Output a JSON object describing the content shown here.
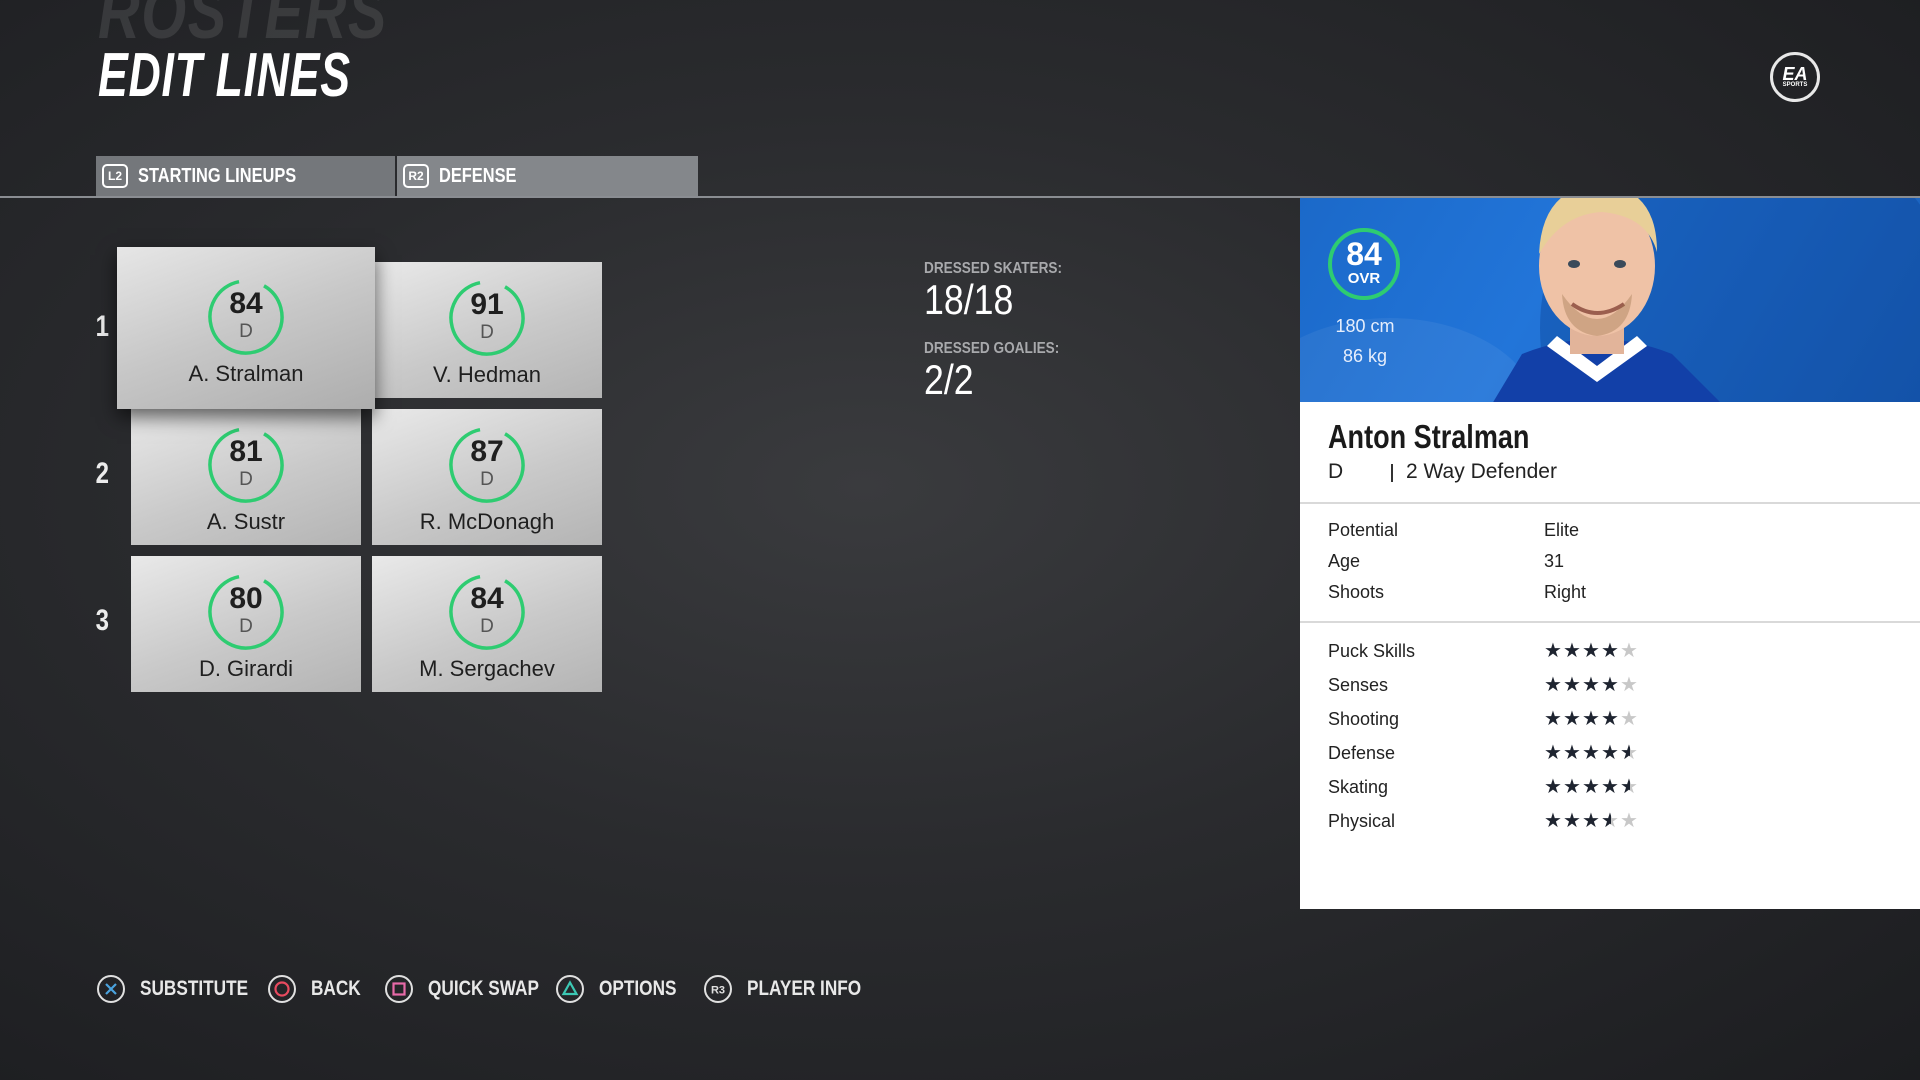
{
  "header": {
    "bg_title": "ROSTERS",
    "title": "EDIT LINES",
    "logo_text": "EA",
    "logo_sub": "SPORTS"
  },
  "tabs": [
    {
      "badge": "L2",
      "label": "STARTING LINEUPS"
    },
    {
      "badge": "R2",
      "label": "DEFENSE"
    }
  ],
  "lines": [
    {
      "number": "1",
      "players": [
        {
          "ovr": 84,
          "pos": "D",
          "name": "A. Stralman",
          "selected": true
        },
        {
          "ovr": 91,
          "pos": "D",
          "name": "V. Hedman"
        }
      ]
    },
    {
      "number": "2",
      "players": [
        {
          "ovr": 81,
          "pos": "D",
          "name": "A. Sustr"
        },
        {
          "ovr": 87,
          "pos": "D",
          "name": "R. McDonagh"
        }
      ]
    },
    {
      "number": "3",
      "players": [
        {
          "ovr": 80,
          "pos": "D",
          "name": "D. Girardi"
        },
        {
          "ovr": 84,
          "pos": "D",
          "name": "M. Sergachev"
        }
      ]
    }
  ],
  "dressed": {
    "skaters_label": "DRESSED SKATERS:",
    "skaters_value": "18/18",
    "goalies_label": "DRESSED GOALIES:",
    "goalies_value": "2/2"
  },
  "player": {
    "ovr": "84",
    "ovr_label": "OVR",
    "height": "180 cm",
    "weight": "86 kg",
    "name": "Anton Stralman",
    "position": "D",
    "type": "2 Way Defender",
    "info": [
      {
        "label": "Potential",
        "value": "Elite"
      },
      {
        "label": "Age",
        "value": "31"
      },
      {
        "label": "Shoots",
        "value": "Right"
      }
    ],
    "attributes": [
      {
        "label": "Puck Skills",
        "stars": 4,
        "max": 5
      },
      {
        "label": "Senses",
        "stars": 4,
        "max": 5
      },
      {
        "label": "Shooting",
        "stars": 4,
        "max": 5
      },
      {
        "label": "Defense",
        "stars": 4.5,
        "max": 5
      },
      {
        "label": "Skating",
        "stars": 4.5,
        "max": 5
      },
      {
        "label": "Physical",
        "stars": 3.5,
        "max": 5
      }
    ],
    "header_color": "#1f6fd1"
  },
  "footer": [
    {
      "icon": "cross-button-icon",
      "label": "SUBSTITUTE"
    },
    {
      "icon": "circle-button-icon",
      "label": "BACK"
    },
    {
      "icon": "square-button-icon",
      "label": "QUICK SWAP"
    },
    {
      "icon": "triangle-button-icon",
      "label": "OPTIONS"
    },
    {
      "icon": "r3-button-icon",
      "badge": "R3",
      "label": "PLAYER INFO"
    }
  ],
  "colors": {
    "ring_green": "#2ecc71",
    "cross_blue": "#4aa3df",
    "circle_red": "#e84a5f",
    "square_pink": "#e86aa8",
    "triangle_teal": "#3cc8b4"
  }
}
